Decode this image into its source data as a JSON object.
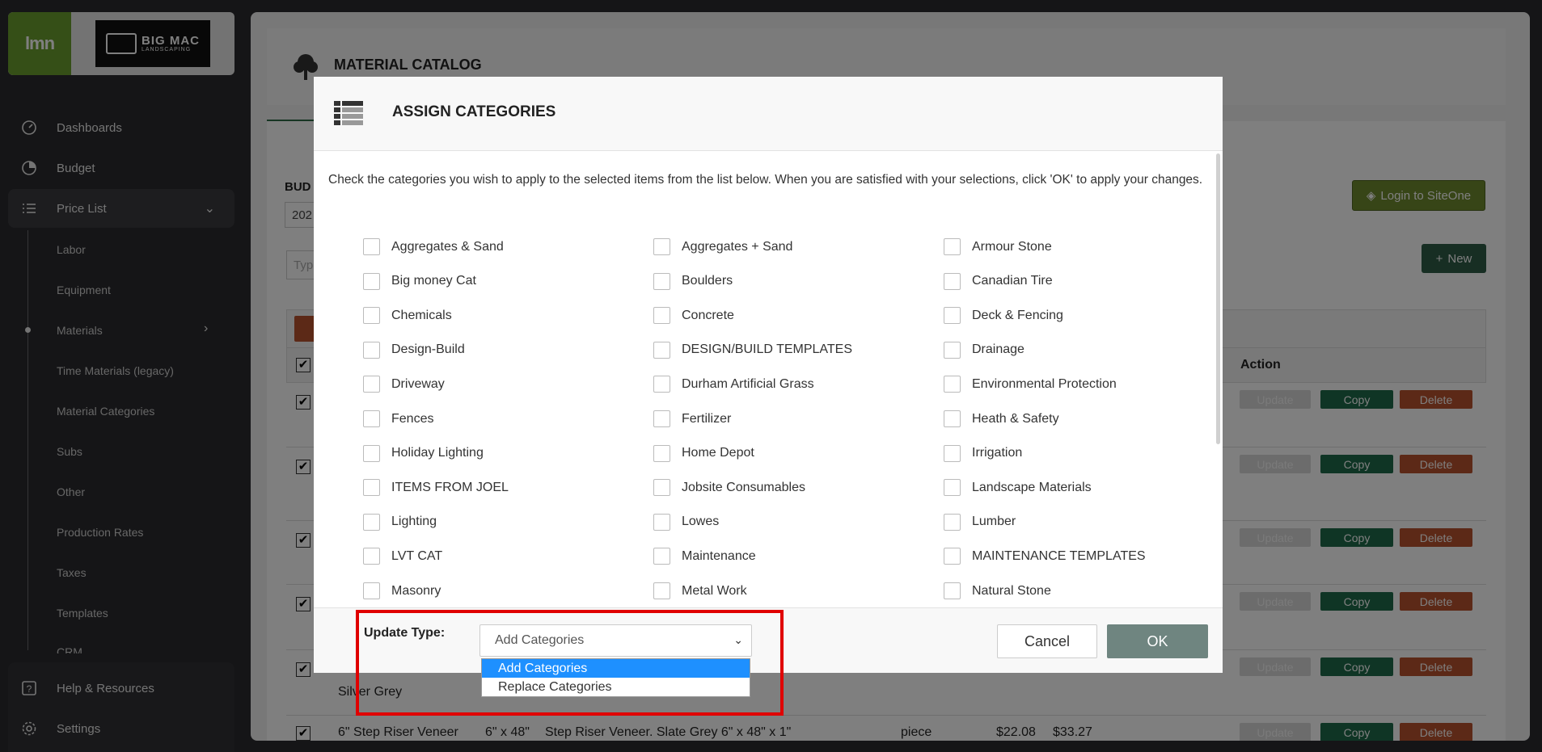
{
  "sidebar": {
    "logo_left": "lmn",
    "logo_right": "BIG MAC",
    "logo_right_sub": "LANDSCAPING",
    "items": [
      {
        "label": "Dashboards",
        "icon": "gauge-icon"
      },
      {
        "label": "Budget",
        "icon": "pie-chart-icon"
      },
      {
        "label": "Price List",
        "icon": "list-icon"
      }
    ],
    "sub_items": [
      "Labor",
      "Equipment",
      "Materials",
      "Time Materials (legacy)",
      "Material Categories",
      "Subs",
      "Other",
      "Production Rates",
      "Taxes",
      "Templates",
      "CRM"
    ],
    "bottom_items": [
      {
        "label": "Help & Resources",
        "icon": "help-icon"
      },
      {
        "label": "Settings",
        "icon": "gear-icon"
      }
    ]
  },
  "main": {
    "title": "MATERIAL CATALOG",
    "bud_label": "BUD",
    "year_partial": "202",
    "type_partial": "Typ",
    "siteone_label": "Login to SiteOne",
    "new_label": "New",
    "action_header": "Action",
    "row_buttons": {
      "update": "Update",
      "copy": "Copy",
      "delete": "Delete"
    },
    "partial_row": {
      "desc": "Silver Grey"
    },
    "last_row": {
      "name": "6\" Step Riser Veneer",
      "size": "6\" x 48\"",
      "desc": "Step Riser Veneer. Slate Grey 6\" x 48\" x 1\"",
      "unit": "piece",
      "cost": "$22.08",
      "price": "$33.27"
    }
  },
  "modal": {
    "title": "ASSIGN CATEGORIES",
    "instructions": "Check the categories you wish to apply to the selected items from the list below. When you are satisfied with your selections, click 'OK' to apply your changes.",
    "categories": [
      "Aggregates & Sand",
      "Aggregates + Sand",
      "Armour Stone",
      "Big money Cat",
      "Boulders",
      "Canadian Tire",
      "Chemicals",
      "Concrete",
      "Deck & Fencing",
      "Design-Build",
      "DESIGN/BUILD TEMPLATES",
      "Drainage",
      "Driveway",
      "Durham Artificial Grass",
      "Environmental Protection",
      "Fences",
      "Fertilizer",
      "Heath & Safety",
      "Holiday Lighting",
      "Home Depot",
      "Irrigation",
      "ITEMS FROM JOEL",
      "Jobsite Consumables",
      "Landscape Materials",
      "Lighting",
      "Lowes",
      "Lumber",
      "LVT CAT",
      "Maintenance",
      "MAINTENANCE TEMPLATES",
      "Masonry",
      "Metal Work",
      "Natural Stone"
    ],
    "update_type_label": "Update Type:",
    "update_type_value": "Add Categories",
    "update_type_options": [
      "Add Categories",
      "Replace Categories"
    ],
    "cancel_label": "Cancel",
    "ok_label": "OK"
  }
}
